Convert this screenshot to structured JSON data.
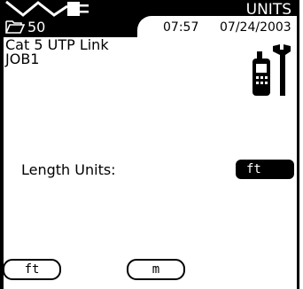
{
  "header": {
    "title": "UNITS",
    "folder_count": "50",
    "time": "07:57",
    "date": "07/24/2003",
    "icons": [
      "cable-link-icon",
      "folder-icon"
    ]
  },
  "info": {
    "line1": "Cat 5 UTP Link",
    "line2": "JOB1",
    "icon": "tester-tools-icon"
  },
  "setting": {
    "label": "Length Units:",
    "value": "ft"
  },
  "softkeys": [
    {
      "label": "ft"
    },
    {
      "label": "m"
    }
  ]
}
